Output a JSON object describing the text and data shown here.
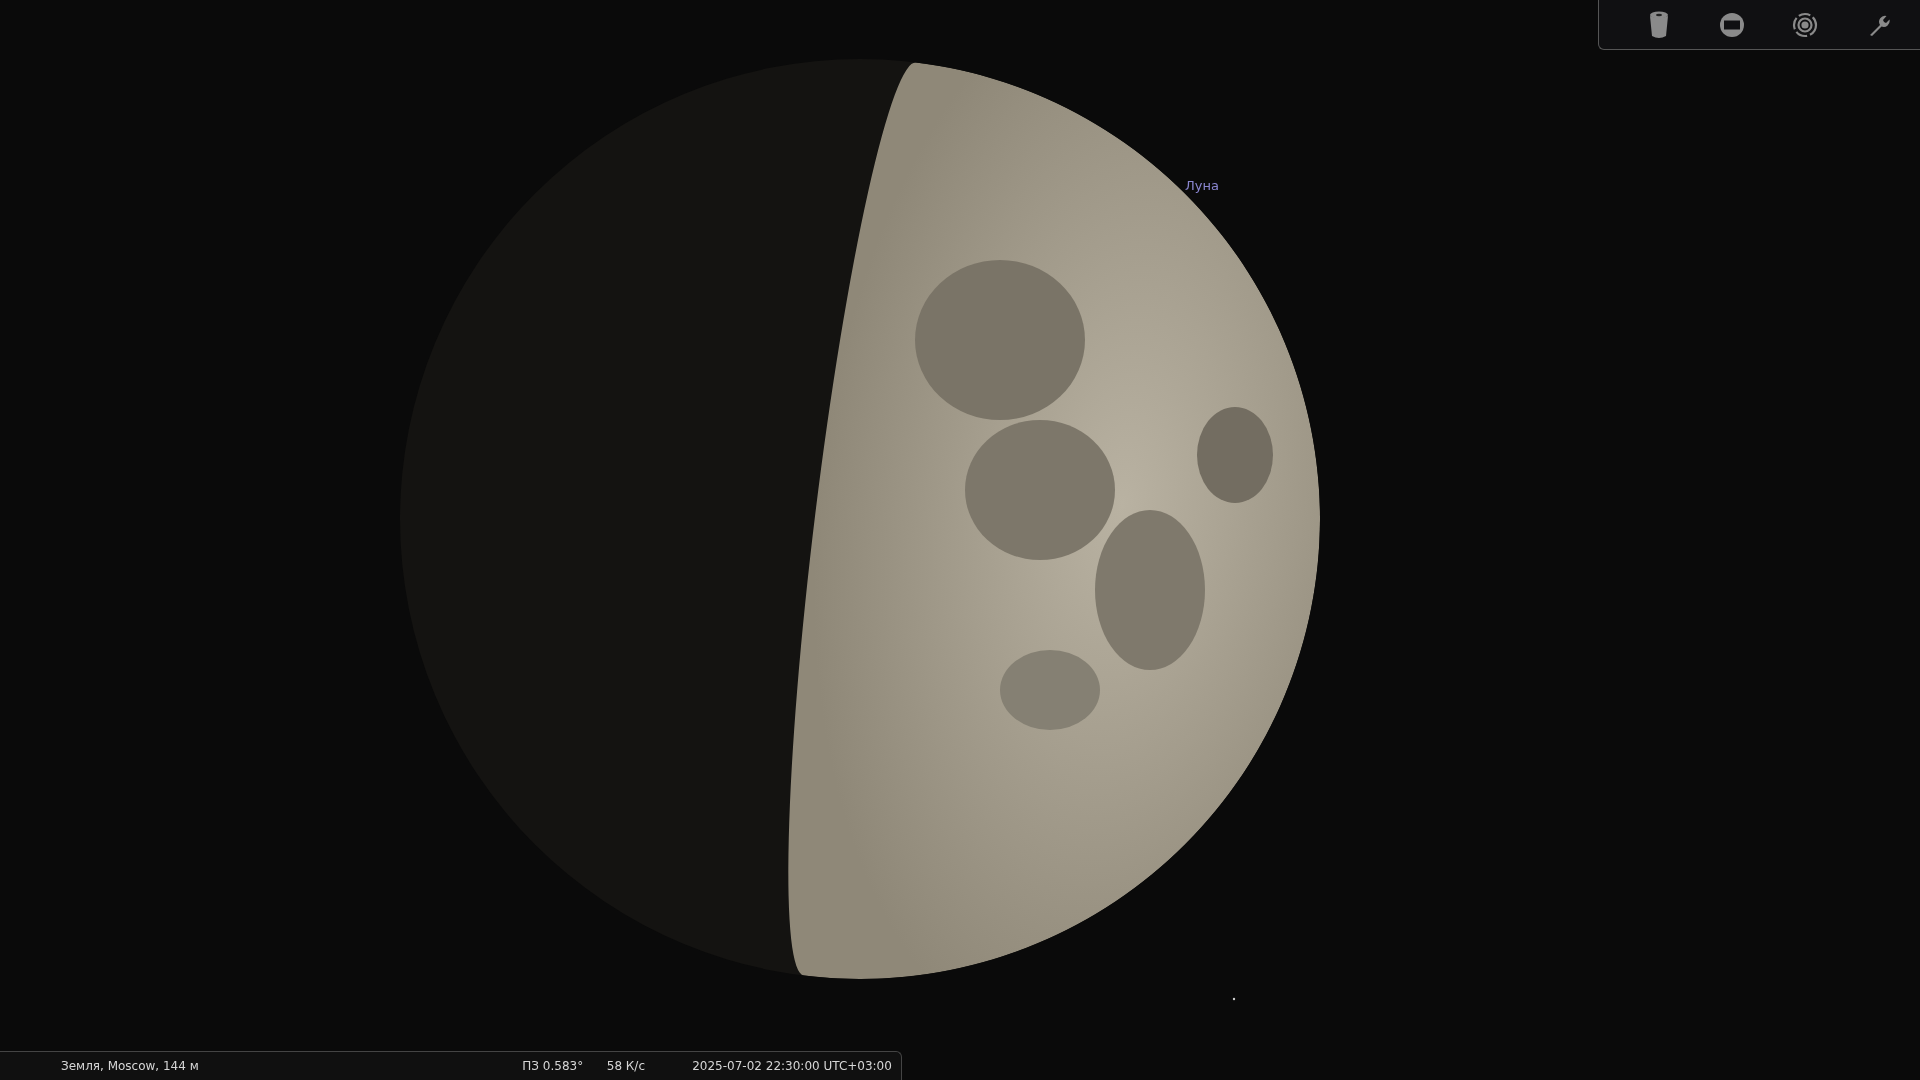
{
  "object_label": "Луна",
  "status_bar": {
    "location": "Земля, Moscow, 144 м",
    "fov": "ПЗ 0.583°",
    "fps": "58 К/с",
    "datetime": "2025-07-02 22:30:00 UTC+03:00"
  }
}
